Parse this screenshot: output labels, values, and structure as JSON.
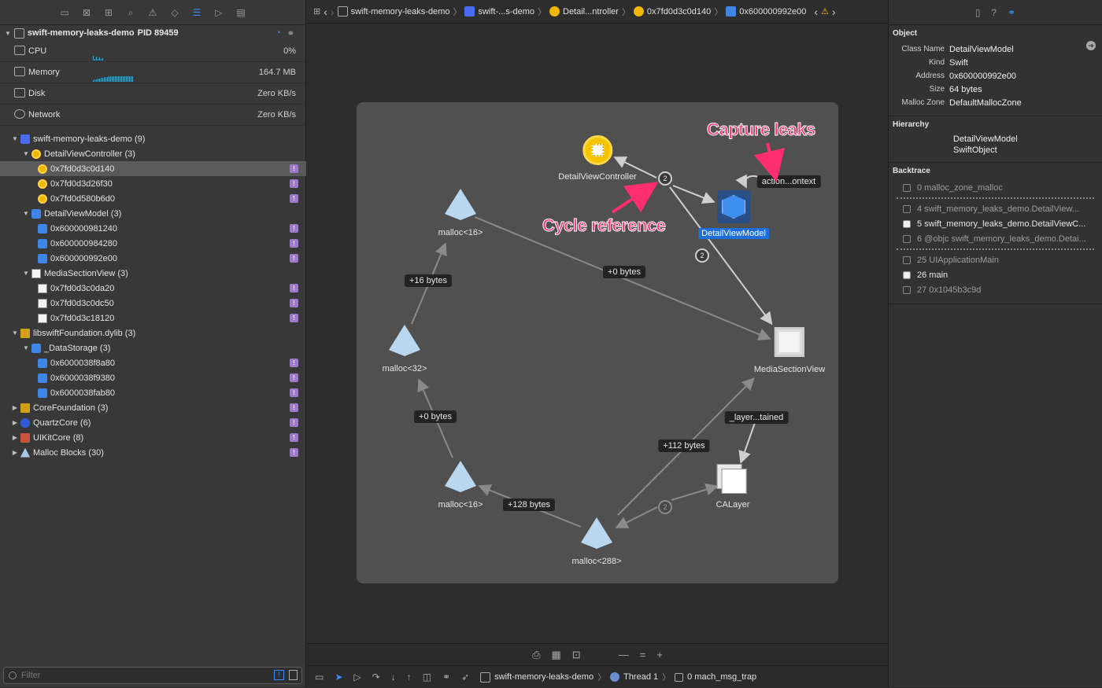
{
  "navigator": {
    "process": {
      "name": "swift-memory-leaks-demo",
      "pid": "PID 89459"
    },
    "gauges": [
      {
        "label": "CPU",
        "value": "0%"
      },
      {
        "label": "Memory",
        "value": "164.7 MB"
      },
      {
        "label": "Disk",
        "value": "Zero KB/s"
      },
      {
        "label": "Network",
        "value": "Zero KB/s"
      }
    ],
    "tree": [
      {
        "label": "swift-memory-leaks-demo (9)",
        "icon": "person-icon",
        "level": 0
      },
      {
        "label": "DetailViewController (3)",
        "icon": "class-yellow-icon",
        "level": 1
      },
      {
        "label": "0x7fd0d3c0d140",
        "icon": "instance-yellow-icon",
        "level": 2
      },
      {
        "label": "0x7fd0d3d26f30",
        "icon": "instance-yellow-icon",
        "level": 2
      },
      {
        "label": "0x7fd0d580b6d0",
        "icon": "instance-yellow-icon",
        "level": 2
      },
      {
        "label": "DetailViewModel (3)",
        "icon": "cube-icon",
        "level": 1
      },
      {
        "label": "0x600000981240",
        "icon": "cube-icon",
        "level": 2
      },
      {
        "label": "0x600000984280",
        "icon": "cube-icon",
        "level": 2
      },
      {
        "label": "0x600000992e00",
        "icon": "cube-icon",
        "level": 2
      },
      {
        "label": "MediaSectionView (3)",
        "icon": "view-icon",
        "level": 1
      },
      {
        "label": "0x7fd0d3c0da20",
        "icon": "view-icon",
        "level": 2
      },
      {
        "label": "0x7fd0d3c0dc50",
        "icon": "view-icon",
        "level": 2
      },
      {
        "label": "0x7fd0d3c18120",
        "icon": "view-icon",
        "level": 2
      },
      {
        "label": "libswiftFoundation.dylib (3)",
        "icon": "library-icon",
        "level": 0
      },
      {
        "label": "_DataStorage (3)",
        "icon": "cube-icon",
        "level": 1
      },
      {
        "label": "0x6000038f8a80",
        "icon": "cube-icon",
        "level": 2
      },
      {
        "label": "0x6000038f9380",
        "icon": "cube-icon",
        "level": 2
      },
      {
        "label": "0x6000038fab80",
        "icon": "cube-icon",
        "level": 2
      },
      {
        "label": "CoreFoundation (3)",
        "icon": "library-icon",
        "level": 0
      },
      {
        "label": "QuartzCore (6)",
        "icon": "quartz-icon",
        "level": 0
      },
      {
        "label": "UIKitCore (8)",
        "icon": "uikit-icon",
        "level": 0
      },
      {
        "label": "Malloc Blocks (30)",
        "icon": "malloc-icon",
        "level": 0
      }
    ],
    "filter_placeholder": "Filter"
  },
  "jumpbar": {
    "items": [
      "swift-memory-leaks-demo",
      "swift-...s-demo",
      "Detail...ntroller",
      "0x7fd0d3c0d140",
      "0x600000992e00"
    ]
  },
  "graph": {
    "nodes": {
      "detail_vc": "DetailViewController",
      "detail_vm": "DetailViewModel",
      "malloc16a": "malloc<16>",
      "malloc32": "malloc<32>",
      "malloc16b": "malloc<16>",
      "malloc288": "malloc<288>",
      "media": "MediaSectionView",
      "calayer": "CALayer"
    },
    "edges": {
      "e1": "+16 bytes",
      "e2": "+0 bytes",
      "e3": "+0 bytes",
      "e4": "+128 bytes",
      "e5": "+112 bytes",
      "e6": "_layer...tained",
      "e7": "action...ontext"
    },
    "counts": {
      "c1": "2",
      "c2": "2",
      "c3": "2"
    },
    "annotations": {
      "capture": "Capture leaks",
      "cycle": "Cycle reference"
    }
  },
  "debugbar": {
    "process": "swift-memory-leaks-demo",
    "thread": "Thread 1",
    "frame": "0 mach_msg_trap"
  },
  "inspector": {
    "object_title": "Object",
    "object": [
      {
        "k": "Class Name",
        "v": "DetailViewModel"
      },
      {
        "k": "Kind",
        "v": "Swift"
      },
      {
        "k": "Address",
        "v": "0x600000992e00"
      },
      {
        "k": "Size",
        "v": "64 bytes"
      },
      {
        "k": "Malloc Zone",
        "v": "DefaultMallocZone"
      }
    ],
    "hierarchy_title": "Hierarchy",
    "hierarchy": [
      "DetailViewModel",
      "SwiftObject"
    ],
    "backtrace_title": "Backtrace",
    "backtrace": [
      {
        "t": "0 malloc_zone_malloc",
        "dim": true
      },
      {
        "t": "4 swift_memory_leaks_demo.DetailView...",
        "dim": true
      },
      {
        "t": "5 swift_memory_leaks_demo.DetailViewC...",
        "dim": false
      },
      {
        "t": "6 @objc swift_memory_leaks_demo.Detai...",
        "dim": true
      },
      {
        "t": "25 UIApplicationMain",
        "dim": true
      },
      {
        "t": "26 main",
        "dim": false
      },
      {
        "t": "27 0x1045b3c9d",
        "dim": true
      }
    ]
  },
  "colors": {
    "accent": "#3a8ef6",
    "annotation": "#ff2e6e",
    "leak_badge": "#9b7bc9",
    "selected_node": "#1e6fdc"
  }
}
